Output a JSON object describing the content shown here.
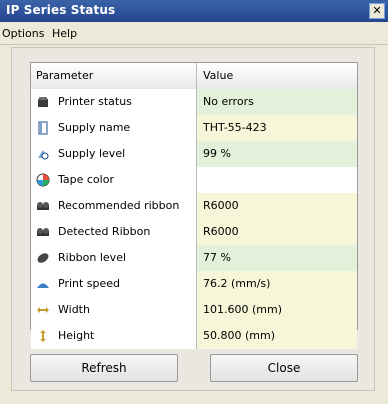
{
  "window": {
    "title": "IP Series Status",
    "close_glyph": "✕"
  },
  "menu": {
    "items": [
      "Options",
      "Help"
    ]
  },
  "table": {
    "headers": [
      "Parameter",
      "Value"
    ],
    "rows": [
      {
        "label": "Printer status",
        "value": "No errors",
        "icon": "printer-icon",
        "value_bg": "#e3f0da"
      },
      {
        "label": "Supply name",
        "value": "THT-55-423",
        "icon": "supply-icon",
        "value_bg": "#f6f7d8"
      },
      {
        "label": "Supply level",
        "value": "99 %",
        "icon": "supply-level-icon",
        "value_bg": "#e3f0da"
      },
      {
        "label": "Tape color",
        "value": "",
        "icon": "color-icon",
        "value_bg": "#ffffff"
      },
      {
        "label": "Recommended ribbon",
        "value": "R6000",
        "icon": "ribbon-icon",
        "value_bg": "#f6f7d8"
      },
      {
        "label": "Detected Ribbon",
        "value": "R6000",
        "icon": "ribbon-icon",
        "value_bg": "#f6f7d8"
      },
      {
        "label": "Ribbon level",
        "value": "77 %",
        "icon": "ribbon-level-icon",
        "value_bg": "#e3f0da"
      },
      {
        "label": "Print speed",
        "value": "76.2 (mm/s)",
        "icon": "speed-icon",
        "value_bg": "#f6f7d8"
      },
      {
        "label": "Width",
        "value": "101.600 (mm)",
        "icon": "width-icon",
        "value_bg": "#f6f7d8"
      },
      {
        "label": "Height",
        "value": "50.800 (mm)",
        "icon": "height-icon",
        "value_bg": "#f6f7d8"
      }
    ]
  },
  "buttons": {
    "refresh": "Refresh",
    "close": "Close"
  }
}
